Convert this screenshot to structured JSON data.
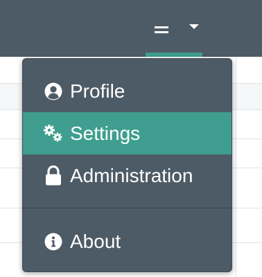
{
  "colors": {
    "navbar_bg": "#4d5b66",
    "accent": "#3f9e8f",
    "text": "#ffffff"
  },
  "navbar": {
    "menu_icon": "hamburger-icon",
    "dropdown_icon": "caret-down-icon"
  },
  "dropdown": {
    "items": [
      {
        "label": "Profile",
        "icon": "user-circle-icon",
        "active": false
      },
      {
        "label": "Settings",
        "icon": "cogs-icon",
        "active": true
      },
      {
        "label": "Administration",
        "icon": "lock-icon",
        "active": false
      },
      {
        "label": "About",
        "icon": "info-circle-icon",
        "active": false
      }
    ]
  }
}
